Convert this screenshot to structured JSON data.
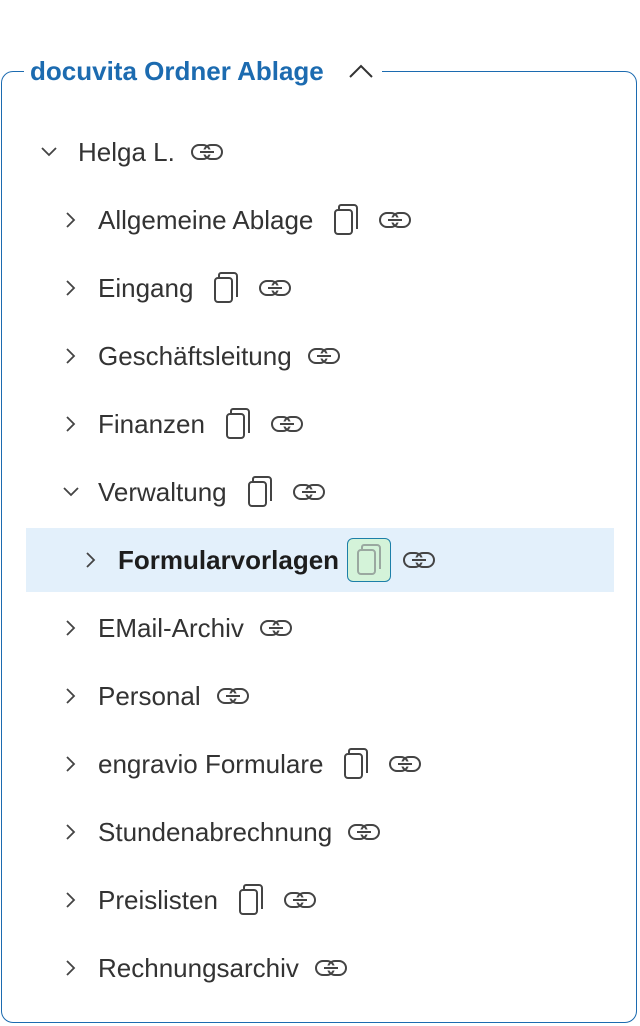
{
  "section": {
    "title": "docuvita Ordner Ablage",
    "toggle_icon": "chevron-up-icon",
    "accent_color": "#1c6bb0"
  },
  "tree": {
    "root": {
      "label": "Helga L.",
      "expanded": true
    },
    "items": [
      {
        "label": "Allgemeine Ablage",
        "has_copy": true
      },
      {
        "label": "Eingang",
        "has_copy": true
      },
      {
        "label": "Geschäftsleitung",
        "has_copy": false
      },
      {
        "label": "Finanzen",
        "has_copy": true
      },
      {
        "label": "Verwaltung",
        "has_copy": true,
        "expanded": true
      },
      {
        "label": "Formularvorlagen",
        "has_copy": true,
        "selected": true
      },
      {
        "label": "EMail-Archiv",
        "has_copy": false
      },
      {
        "label": "Personal",
        "has_copy": false
      },
      {
        "label": "engravio Formulare",
        "has_copy": true
      },
      {
        "label": "Stundenabrechnung",
        "has_copy": false
      },
      {
        "label": "Preislisten",
        "has_copy": true
      },
      {
        "label": "Rechnungsarchiv",
        "has_copy": false
      }
    ],
    "selected_bg": "#e3f0fb",
    "selected_copy_bg": "#d4f3d9"
  }
}
